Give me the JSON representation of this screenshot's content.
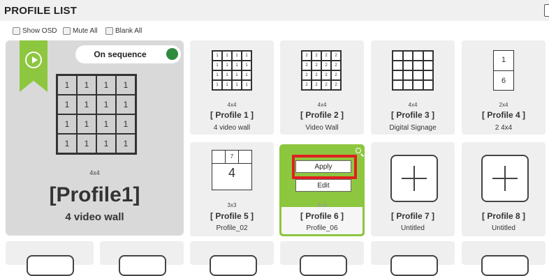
{
  "header": {
    "title": "PROFILE LIST"
  },
  "options": [
    {
      "label": "Show OSD"
    },
    {
      "label": "Mute All"
    },
    {
      "label": "Blank All"
    }
  ],
  "current": {
    "sequence_label": "On sequence",
    "layout_size": "4x4",
    "cells": [
      "1",
      "1",
      "1",
      "1",
      "1",
      "1",
      "1",
      "1",
      "1",
      "1",
      "1",
      "1",
      "1",
      "1",
      "1",
      "1"
    ],
    "name": "[Profile1]",
    "description": "4 video wall",
    "colors": {
      "ribbon": "#8dc63f",
      "sequence_dot": "#2e8b3e"
    }
  },
  "profiles": [
    {
      "size": "4x4",
      "name": "[ Profile 1 ]",
      "description": "4 video wall",
      "cells": [
        "1",
        "1",
        "1",
        "1",
        "1",
        "1",
        "1",
        "1",
        "1",
        "1",
        "1",
        "1",
        "1",
        "1",
        "1",
        "1"
      ]
    },
    {
      "size": "4x4",
      "name": "[ Profile 2 ]",
      "description": "Video Wall",
      "cells": [
        "2",
        "2",
        "2",
        "2",
        "2",
        "2",
        "2",
        "2",
        "2",
        "2",
        "2",
        "2",
        "2",
        "2",
        "2",
        "2"
      ]
    },
    {
      "size": "4x4",
      "name": "[ Profile 3 ]",
      "description": "Digital Signage",
      "cells": []
    },
    {
      "size": "2x4",
      "name": "[ Profile 4 ]",
      "description": "2 4x4",
      "cells": [
        "1",
        "6"
      ]
    },
    {
      "size": "3x3",
      "name": "[ Profile 5 ]",
      "description": "Profile_02",
      "cells": [
        "7",
        "4"
      ]
    },
    {
      "size": "4x4",
      "name": "[ Profile 6 ]",
      "description": "Profile_06",
      "selected": true
    },
    {
      "name": "[ Profile 7 ]",
      "description": "Untitled",
      "empty": true
    },
    {
      "name": "[ Profile 8 ]",
      "description": "Untitled",
      "empty": true
    }
  ],
  "actions": {
    "apply": "Apply",
    "edit": "Edit"
  },
  "colors": {
    "accent": "#8dc63f",
    "highlight": "#e02020"
  }
}
